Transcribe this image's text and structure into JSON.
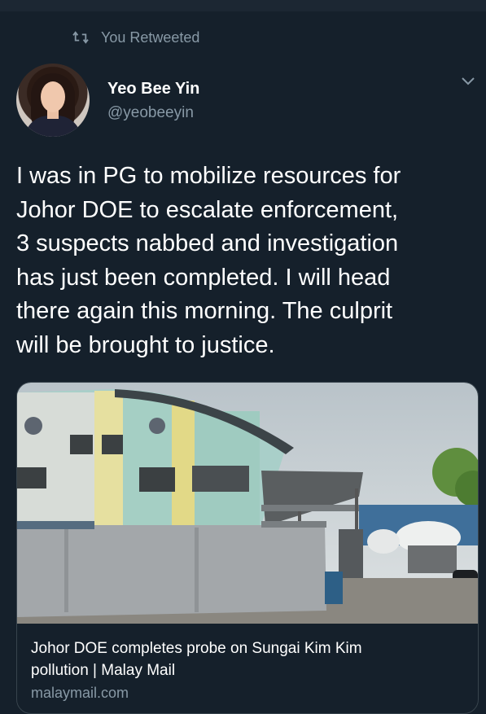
{
  "retweet": {
    "icon": "retweet-icon",
    "label": "You Retweeted"
  },
  "user": {
    "name": "Yeo Bee Yin",
    "handle": "@yeobeeyin",
    "avatar_icon": "avatar"
  },
  "menu": {
    "icon": "chevron-down-icon"
  },
  "tweet": {
    "lines": [
      "I was in PG to mobilize resources for",
      "Johor DOE to escalate enforcement,",
      "3 suspects nabbed and investigation",
      "has just been completed. I will head",
      "there again this morning. The culprit",
      "will be brought to justice."
    ]
  },
  "card": {
    "image_icon": "article-photo",
    "title_lines": [
      "Johor DOE completes probe on Sungai Kim Kim",
      "pollution | Malay Mail"
    ],
    "domain": "malaymail.com"
  },
  "colors": {
    "background": "#15202b",
    "secondary_text": "#8899a6",
    "border": "#38444d"
  }
}
